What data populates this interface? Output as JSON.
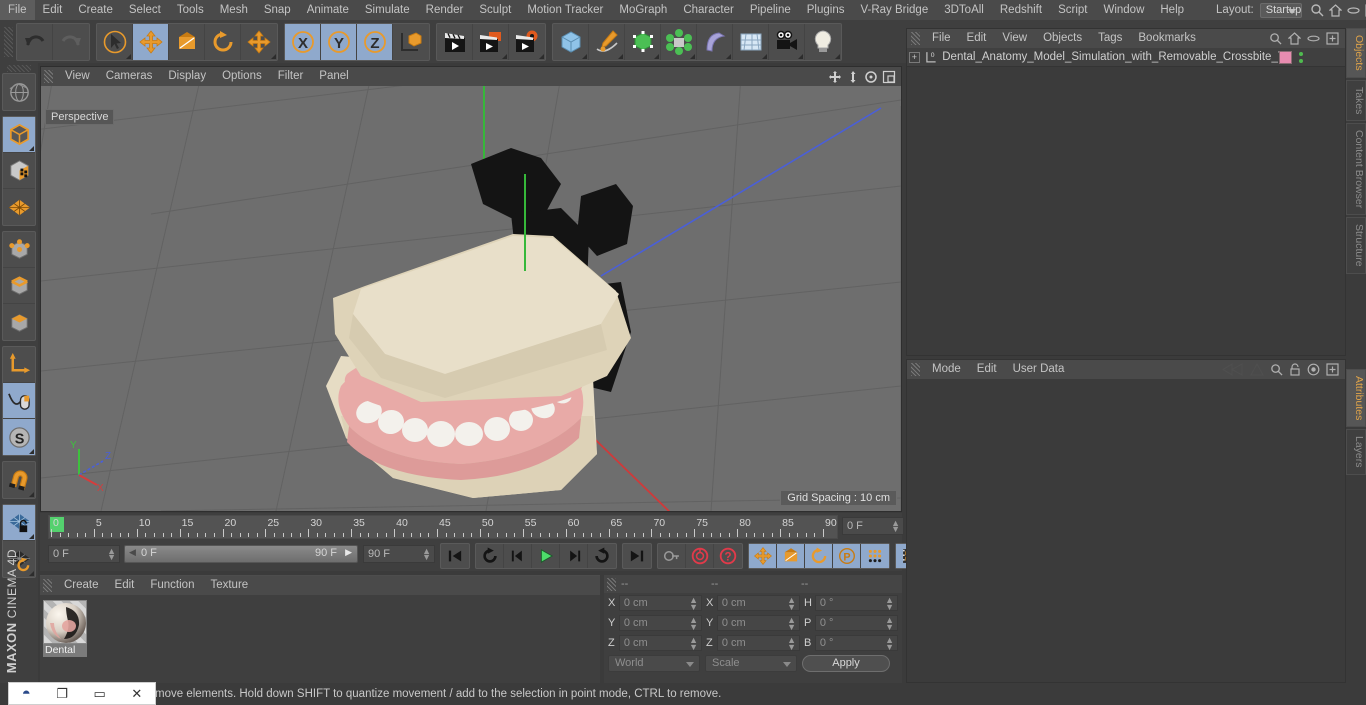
{
  "app": {
    "brand_top": "MAXON",
    "brand_sub": "CINEMA 4D"
  },
  "menubar": {
    "items": [
      {
        "label": "File"
      },
      {
        "label": "Edit"
      },
      {
        "label": "Create"
      },
      {
        "label": "Select"
      },
      {
        "label": "Tools"
      },
      {
        "label": "Mesh"
      },
      {
        "label": "Snap"
      },
      {
        "label": "Animate"
      },
      {
        "label": "Simulate"
      },
      {
        "label": "Render"
      },
      {
        "label": "Sculpt"
      },
      {
        "label": "Motion Tracker"
      },
      {
        "label": "MoGraph"
      },
      {
        "label": "Character"
      },
      {
        "label": "Pipeline"
      },
      {
        "label": "Plugins"
      },
      {
        "label": "V-Ray Bridge"
      },
      {
        "label": "3DToAll"
      },
      {
        "label": "Redshift"
      },
      {
        "label": "Script"
      },
      {
        "label": "Window"
      },
      {
        "label": "Help"
      }
    ],
    "layout_label": "Layout:",
    "layout_value": "Startup"
  },
  "toolbar": {
    "groups": [
      {
        "name": "history",
        "buttons": [
          {
            "name": "undo-button",
            "icon": "undo-icon",
            "selected": false,
            "corner": false
          },
          {
            "name": "redo-button",
            "icon": "redo-icon",
            "selected": false,
            "corner": false
          }
        ]
      },
      {
        "name": "transform-tools",
        "buttons": [
          {
            "name": "live-selection-tool",
            "icon": "cursor-circle-icon",
            "selected": false,
            "corner": true
          },
          {
            "name": "move-tool",
            "icon": "move-arrows-icon",
            "selected": true,
            "corner": false
          },
          {
            "name": "scale-tool",
            "icon": "scale-box-icon",
            "selected": false,
            "corner": false
          },
          {
            "name": "rotate-tool",
            "icon": "rotate-arrow-icon",
            "selected": false,
            "corner": false
          },
          {
            "name": "axis-move-tool",
            "icon": "move-arrows-icon",
            "selected": false,
            "corner": true
          }
        ]
      },
      {
        "name": "axis-locks",
        "buttons": [
          {
            "name": "x-axis-lock",
            "icon": "x-axis-icon",
            "selected": true,
            "corner": false
          },
          {
            "name": "y-axis-lock",
            "icon": "y-axis-icon",
            "selected": true,
            "corner": false
          },
          {
            "name": "z-axis-lock",
            "icon": "z-axis-icon",
            "selected": true,
            "corner": false
          },
          {
            "name": "world-object-coordinate-toggle",
            "icon": "world-axis-cube-icon",
            "selected": false,
            "corner": false
          }
        ]
      },
      {
        "name": "render-group",
        "buttons": [
          {
            "name": "render-view-button",
            "icon": "clapper-icon",
            "selected": false,
            "corner": false
          },
          {
            "name": "render-to-picture-viewer-button",
            "icon": "clapper-picture-icon",
            "selected": false,
            "corner": true
          },
          {
            "name": "render-settings-button",
            "icon": "clapper-gear-icon",
            "selected": false,
            "corner": true
          }
        ]
      },
      {
        "name": "create-group",
        "buttons": [
          {
            "name": "add-cube-button",
            "icon": "cube-icon",
            "selected": false,
            "corner": true
          },
          {
            "name": "add-spline-button",
            "icon": "pen-spline-icon",
            "selected": false,
            "corner": true
          },
          {
            "name": "add-generator-button",
            "icon": "generator-cube-icon",
            "selected": false,
            "corner": true
          },
          {
            "name": "add-mograph-button",
            "icon": "mograph-cloner-icon",
            "selected": false,
            "corner": true
          },
          {
            "name": "add-deformer-button",
            "icon": "bend-deformer-icon",
            "selected": false,
            "corner": true
          },
          {
            "name": "add-scene-button",
            "icon": "floor-grid-icon",
            "selected": false,
            "corner": true
          },
          {
            "name": "add-camera-button",
            "icon": "camera-icon",
            "selected": false,
            "corner": true
          },
          {
            "name": "add-light-button",
            "icon": "light-bulb-icon",
            "selected": false,
            "corner": true
          }
        ]
      }
    ]
  },
  "left_toolbar": {
    "groups": [
      {
        "buttons": [
          {
            "name": "undo-view-button",
            "icon": "globe-grid-icon",
            "selected": false,
            "corner": false
          }
        ]
      },
      {
        "buttons": [
          {
            "name": "make-editable-button",
            "icon": "editable-cube-icon",
            "selected": true,
            "corner": true
          },
          {
            "name": "model-mode-button",
            "icon": "texture-cube-icon",
            "selected": false,
            "corner": false
          },
          {
            "name": "texture-mode-button",
            "icon": "orange-grid-icon",
            "selected": false,
            "corner": false
          }
        ]
      },
      {
        "buttons": [
          {
            "name": "points-mode-button",
            "icon": "point-cube-icon",
            "selected": false,
            "corner": false
          },
          {
            "name": "edges-mode-button",
            "icon": "edge-cube-icon",
            "selected": false,
            "corner": false
          },
          {
            "name": "polygons-mode-button",
            "icon": "polygon-cube-icon",
            "selected": false,
            "corner": false
          }
        ]
      },
      {
        "buttons": [
          {
            "name": "object-axis-mode-button",
            "icon": "axis-l-icon",
            "selected": false,
            "corner": false
          },
          {
            "name": "enable-axis-button",
            "icon": "mouse-spline-icon",
            "selected": true,
            "corner": false
          },
          {
            "name": "viewport-solo-button",
            "icon": "solo-s-icon",
            "selected": true,
            "corner": true
          }
        ]
      },
      {
        "buttons": [
          {
            "name": "snap-magnet-button",
            "icon": "magnet-icon",
            "selected": false,
            "corner": true
          }
        ]
      },
      {
        "buttons": [
          {
            "name": "lock-workplane-button",
            "icon": "workplane-lock-icon",
            "selected": true,
            "corner": true
          },
          {
            "name": "workplane-rotate-button",
            "icon": "workplane-rotate-icon",
            "selected": false,
            "corner": true
          }
        ]
      }
    ]
  },
  "viewport": {
    "menu": [
      {
        "label": "View"
      },
      {
        "label": "Cameras"
      },
      {
        "label": "Display"
      },
      {
        "label": "Options"
      },
      {
        "label": "Filter"
      },
      {
        "label": "Panel"
      }
    ],
    "view_label": "Perspective",
    "grid_spacing": "Grid Spacing : 10 cm",
    "axis_gizmo": {
      "x": "X",
      "y": "Y",
      "z": "Z"
    },
    "icons": [
      {
        "name": "pan-view-icon"
      },
      {
        "name": "dolly-view-icon"
      },
      {
        "name": "rotate-view-icon"
      },
      {
        "name": "maximize-view-icon"
      }
    ]
  },
  "timeline": {
    "ruler_labels": [
      "0",
      "5",
      "10",
      "15",
      "20",
      "25",
      "30",
      "35",
      "40",
      "45",
      "50",
      "55",
      "60",
      "65",
      "70",
      "75",
      "80",
      "85",
      "90"
    ],
    "current_frame_field": "0 F",
    "range_start": "0 F",
    "range_end": "90 F",
    "end_frame_field": "90 F",
    "right_frame_field": "0 F",
    "transport": [
      {
        "name": "go-to-start-button",
        "icon": "skip-start-icon",
        "selected": false
      },
      {
        "name": "play-backwards-loop-button",
        "icon": "loop-icon",
        "selected": false
      },
      {
        "name": "step-back-button",
        "icon": "step-back-icon",
        "selected": false
      },
      {
        "name": "play-button",
        "icon": "play-icon",
        "selected": false
      },
      {
        "name": "step-forward-button",
        "icon": "step-forward-icon",
        "selected": false
      },
      {
        "name": "play-forward-loop-button",
        "icon": "loop-forward-icon",
        "selected": false
      },
      {
        "name": "go-to-end-button",
        "icon": "skip-end-icon",
        "selected": false
      }
    ],
    "keyframe_tools": [
      {
        "name": "record-active-objects-button",
        "icon": "key-icon",
        "selected": false
      },
      {
        "name": "autokeying-button",
        "icon": "autokey-circle-icon",
        "selected": false
      },
      {
        "name": "keyframe-selection-button",
        "icon": "question-circle-icon",
        "selected": false
      }
    ],
    "key_filters": [
      {
        "name": "position-key-button",
        "icon": "move-arrows-icon",
        "selected": true
      },
      {
        "name": "scale-key-button",
        "icon": "scale-box-icon",
        "selected": true
      },
      {
        "name": "rotation-key-button",
        "icon": "rotate-arrow-icon",
        "selected": true
      },
      {
        "name": "parameter-key-button",
        "icon": "parameter-p-icon",
        "selected": true
      },
      {
        "name": "point-level-animation-button",
        "icon": "pla-dots-icon",
        "selected": true
      },
      {
        "name": "keyframe-selection-toggle",
        "icon": "film-strip-icon",
        "selected": true
      }
    ]
  },
  "materials": {
    "menu": [
      {
        "label": "Create"
      },
      {
        "label": "Edit"
      },
      {
        "label": "Function"
      },
      {
        "label": "Texture"
      }
    ],
    "items": [
      {
        "name": "Dental"
      }
    ]
  },
  "coordinates": {
    "headers": [
      "--",
      "--",
      "--"
    ],
    "position": {
      "label_x": "X",
      "label_y": "Y",
      "label_z": "Z",
      "x": "0 cm",
      "y": "0 cm",
      "z": "0 cm"
    },
    "size": {
      "label_x": "X",
      "label_y": "Y",
      "label_z": "Z",
      "x": "0 cm",
      "y": "0 cm",
      "z": "0 cm"
    },
    "rotation": {
      "label_h": "H",
      "label_p": "P",
      "label_b": "B",
      "h": "0 °",
      "p": "0 °",
      "b": "0 °"
    },
    "coord_system": "World",
    "transform_mode": "Scale",
    "apply_label": "Apply"
  },
  "object_manager": {
    "menu": [
      {
        "label": "File"
      },
      {
        "label": "Edit"
      },
      {
        "label": "View"
      },
      {
        "label": "Objects"
      },
      {
        "label": "Tags"
      },
      {
        "label": "Bookmarks"
      }
    ],
    "icons": [
      {
        "name": "search-icon"
      },
      {
        "name": "home-icon"
      },
      {
        "name": "ellipse-icon"
      },
      {
        "name": "plus-box-icon"
      }
    ],
    "rows": [
      {
        "name": "Dental_Anatomy_Model_Simulation_with_Removable_Crossbite_Te",
        "tag_color": "#e88cb0"
      }
    ]
  },
  "attribute_manager": {
    "menu": [
      {
        "label": "Mode"
      },
      {
        "label": "Edit"
      },
      {
        "label": "User Data"
      }
    ],
    "icons": [
      {
        "name": "history-back-icon"
      },
      {
        "name": "history-forward-icon"
      },
      {
        "name": "search-icon"
      },
      {
        "name": "lock-icon"
      },
      {
        "name": "target-icon"
      },
      {
        "name": "plus-box-icon"
      }
    ]
  },
  "side_tabs": {
    "top": [
      {
        "label": "Objects",
        "active": true
      },
      {
        "label": "Takes",
        "active": false
      },
      {
        "label": "Content Browser",
        "active": false
      },
      {
        "label": "Structure",
        "active": false
      }
    ],
    "bottom": [
      {
        "label": "Attributes",
        "active": true
      },
      {
        "label": "Layers",
        "active": false
      }
    ]
  },
  "statusbar": {
    "message": "move elements. Hold down SHIFT to quantize movement / add to the selection in point mode, CTRL to remove.",
    "taskbar_buttons": [
      {
        "name": "c4d-app-icon",
        "glyph": "◓"
      },
      {
        "name": "restore-window-button",
        "glyph": "❐"
      },
      {
        "name": "minimize-window-button",
        "glyph": "▭"
      },
      {
        "name": "close-window-button",
        "glyph": "✕"
      }
    ]
  }
}
